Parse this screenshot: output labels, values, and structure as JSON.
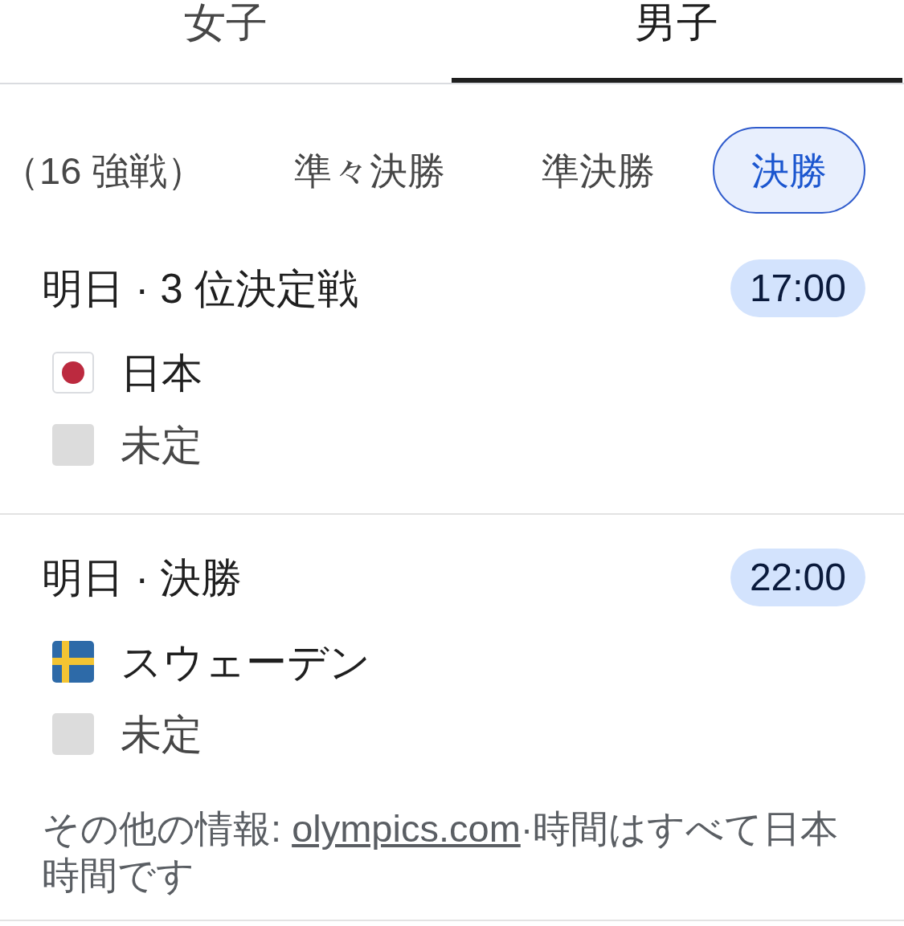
{
  "gender_tabs": [
    {
      "label": "女子",
      "selected": false
    },
    {
      "label": "男子",
      "selected": true
    }
  ],
  "round_chips": [
    {
      "label": "（16 強戦）",
      "selected": false
    },
    {
      "label": "準々決勝",
      "selected": false
    },
    {
      "label": "準決勝",
      "selected": false
    },
    {
      "label": "決勝",
      "selected": true
    }
  ],
  "matches": [
    {
      "title": "明日 · 3 位決定戦",
      "time": "17:00",
      "teams": [
        {
          "name": "日本",
          "kind": "japan"
        },
        {
          "name": "未定",
          "kind": "unknown"
        }
      ]
    },
    {
      "title": "明日 · 決勝",
      "time": "22:00",
      "teams": [
        {
          "name": "スウェーデン",
          "kind": "sweden"
        },
        {
          "name": "未定",
          "kind": "unknown"
        }
      ]
    }
  ],
  "footer": {
    "prefix": "その他の情報:",
    "link": "olympics.com",
    "suffix": "·時間はすべて日本時間です"
  }
}
